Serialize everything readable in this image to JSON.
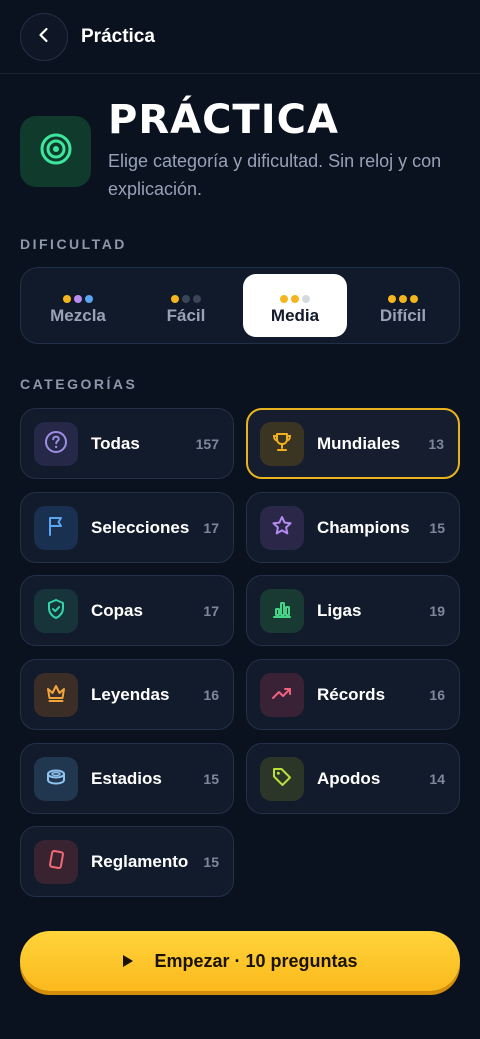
{
  "header": {
    "title": "Práctica",
    "back_icon": "chevron-left-icon"
  },
  "hero": {
    "icon": "target-icon",
    "title": "PRÁCTICA",
    "subtitle": "Elige categoría y dificultad. Sin reloj y con explicación."
  },
  "difficulty": {
    "label": "DIFICULTAD",
    "selected": "Media",
    "options": [
      {
        "label": "Mezcla",
        "dots": [
          "#f5b51e",
          "#b98cf0",
          "#5aa6f0"
        ]
      },
      {
        "label": "Fácil",
        "dots": [
          "#f5b51e",
          "#3a4558",
          "#3a4558"
        ]
      },
      {
        "label": "Media",
        "dots": [
          "#f5b51e",
          "#f5b51e",
          "#d5d9df"
        ]
      },
      {
        "label": "Difícil",
        "dots": [
          "#f5b51e",
          "#f5b51e",
          "#f5b51e"
        ]
      }
    ]
  },
  "categories": {
    "label": "CATEGORÍAS",
    "selected": "Mundiales",
    "items": [
      {
        "name": "Todas",
        "count": "157",
        "icon": "question-circle-icon",
        "color": "#a08ee6",
        "bg": "#262847"
      },
      {
        "name": "Mundiales",
        "count": "13",
        "icon": "trophy-icon",
        "color": "#f2b01e",
        "bg": "#3a3422"
      },
      {
        "name": "Selecciones",
        "count": "17",
        "icon": "flag-icon",
        "color": "#5aa6f0",
        "bg": "#1a3050"
      },
      {
        "name": "Champions",
        "count": "15",
        "icon": "star-icon",
        "color": "#b48cf0",
        "bg": "#2b2748"
      },
      {
        "name": "Copas",
        "count": "17",
        "icon": "shield-check-icon",
        "color": "#35d3a8",
        "bg": "#16343a"
      },
      {
        "name": "Ligas",
        "count": "19",
        "icon": "bar-chart-icon",
        "color": "#46d487",
        "bg": "#183a33"
      },
      {
        "name": "Leyendas",
        "count": "16",
        "icon": "crown-icon",
        "color": "#f2a53c",
        "bg": "#3a2e26"
      },
      {
        "name": "Récords",
        "count": "16",
        "icon": "trending-up-icon",
        "color": "#f0617f",
        "bg": "#3a2236"
      },
      {
        "name": "Estadios",
        "count": "15",
        "icon": "stadium-icon",
        "color": "#8fc3f0",
        "bg": "#21364f"
      },
      {
        "name": "Apodos",
        "count": "14",
        "icon": "tag-icon",
        "color": "#b7e03c",
        "bg": "#2c3628"
      },
      {
        "name": "Reglamento",
        "count": "15",
        "icon": "card-icon",
        "color": "#f06b73",
        "bg": "#3a2330"
      }
    ]
  },
  "start_button": {
    "label": "Empezar · 10 preguntas",
    "icon": "play-icon"
  }
}
